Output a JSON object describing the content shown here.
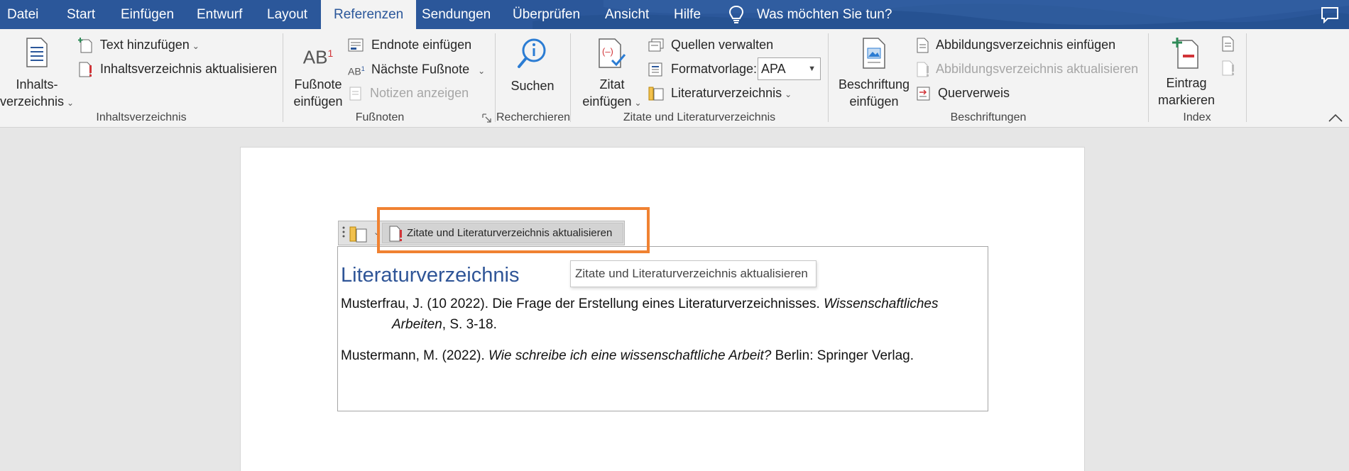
{
  "menubar": {
    "tabs": [
      "Datei",
      "Start",
      "Einfügen",
      "Entwurf",
      "Layout",
      "Referenzen",
      "Sendungen",
      "Überprüfen",
      "Ansicht",
      "Hilfe"
    ],
    "active_tab": "Referenzen",
    "tell_me": "Was möchten Sie tun?",
    "accent_color": "#2b579a"
  },
  "ribbon": {
    "toc": {
      "big_line1": "Inhalts-",
      "big_line2": "verzeichnis",
      "add_text": "Text hinzufügen",
      "update_toc": "Inhaltsverzeichnis aktualisieren",
      "group": "Inhaltsverzeichnis"
    },
    "footnotes": {
      "big_line1": "Fußnote",
      "big_line2": "einfügen",
      "endnote": "Endnote einfügen",
      "next": "Nächste Fußnote",
      "show_notes": "Notizen anzeigen",
      "group": "Fußnoten"
    },
    "research": {
      "big": "Suchen",
      "group": "Recherchieren"
    },
    "citations": {
      "big_line1": "Zitat",
      "big_line2": "einfügen",
      "manage_sources": "Quellen verwalten",
      "style_label": "Formatvorlage:",
      "style_value": "APA",
      "bibliography": "Literaturverzeichnis",
      "group": "Zitate und Literaturverzeichnis"
    },
    "captions": {
      "big_line1": "Beschriftung",
      "big_line2": "einfügen",
      "insert_tof": "Abbildungsverzeichnis einfügen",
      "update_tof": "Abbildungsverzeichnis aktualisieren",
      "cross_ref": "Querverweis",
      "group": "Beschriftungen"
    },
    "index": {
      "big_line1": "Eintrag",
      "big_line2": "markieren",
      "group": "Index"
    }
  },
  "document": {
    "update_button": "Zitate und Literaturverzeichnis aktualisieren",
    "tooltip": "Zitate und Literaturverzeichnis aktualisieren",
    "bib_title": "Literaturverzeichnis",
    "entries": [
      {
        "line1_plain": "Musterfrau, J. (10 2022). Die Frage der Erstellung eines Literaturverzeichnisses. ",
        "line1_italic": "Wissenschaftliches",
        "line2_italic": "Arbeiten",
        "line2_plain": ", S. 3-18."
      },
      {
        "plain1": "Mustermann, M. (2022). ",
        "italic": "Wie schreibe ich eine wissenschaftliche Arbeit?",
        "plain2": " Berlin: Springer Verlag."
      }
    ],
    "highlight_color": "#f08232"
  }
}
